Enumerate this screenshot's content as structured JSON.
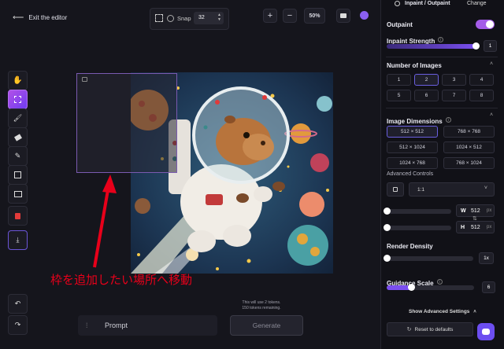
{
  "header": {
    "exit_label": "Exit the editor",
    "snap_label": "Snap",
    "snap_value": "32",
    "zoom_in": "+",
    "zoom_out": "−",
    "zoom_level": "50%"
  },
  "canvas": {
    "annotation": "枠を追加したい場所へ移動",
    "tokens_line1": "This will use 2 tokens.",
    "tokens_line2": "150 tokens remaining."
  },
  "prompt": {
    "label": "Prompt",
    "generate_label": "Generate"
  },
  "panel": {
    "mode_label": "Inpaint / Outpaint",
    "change_label": "Change",
    "outpaint_label": "Outpaint",
    "inpaint_strength_label": "Inpaint Strength",
    "inpaint_strength_value": "1",
    "number_of_images_label": "Number of Images",
    "image_counts": [
      "1",
      "2",
      "3",
      "4",
      "5",
      "6",
      "7",
      "8"
    ],
    "selected_count": "2",
    "image_dimensions_label": "Image Dimensions",
    "dimensions": [
      "512 × 512",
      "768 × 768",
      "512 × 1024",
      "1024 × 512",
      "1024 × 768",
      "768 × 1024"
    ],
    "selected_dimension": "512 × 512",
    "advanced_controls_label": "Advanced Controls",
    "ratio_value": "1:1",
    "width_label": "W",
    "width_value": "512",
    "height_label": "H",
    "height_value": "512",
    "unit": "px",
    "render_density_label": "Render Density",
    "render_density_value": "1x",
    "guidance_scale_label": "Guidance Scale",
    "guidance_scale_value": "6",
    "show_advanced_label": "Show Advanced Settings",
    "reset_label": "Reset to defaults"
  },
  "colors": {
    "accent": "#7b4ff0",
    "annotation_red": "#e8001a",
    "background": "#15151c"
  }
}
